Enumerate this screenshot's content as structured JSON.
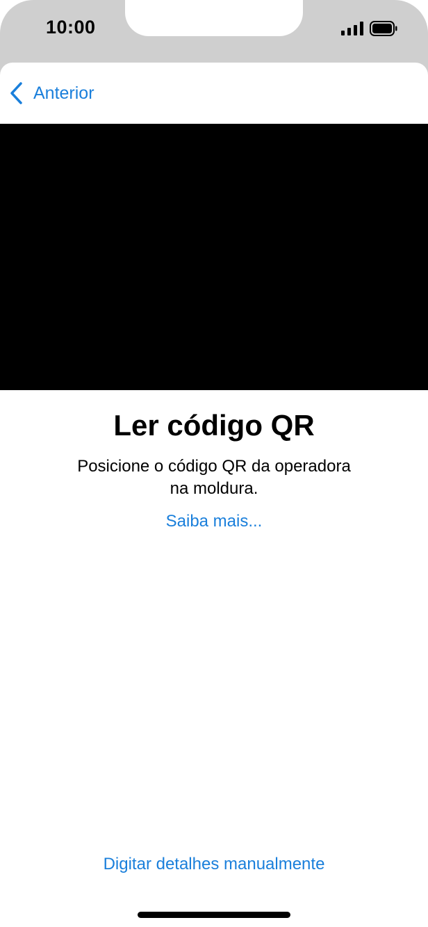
{
  "status_bar": {
    "time": "10:00"
  },
  "navigation": {
    "back_label": "Anterior"
  },
  "content": {
    "title": "Ler código QR",
    "description_line1": "Posicione o código QR da operadora",
    "description_line2": "na moldura.",
    "learn_more": "Saiba mais..."
  },
  "footer": {
    "manual_entry": "Digitar detalhes manualmente"
  },
  "colors": {
    "accent": "#1a7fdb",
    "status_bar_bg": "#cfcfcf",
    "camera_bg": "#000000"
  },
  "icons": {
    "back": "chevron-left-icon",
    "signal": "cellular-signal-icon",
    "battery": "battery-icon"
  }
}
